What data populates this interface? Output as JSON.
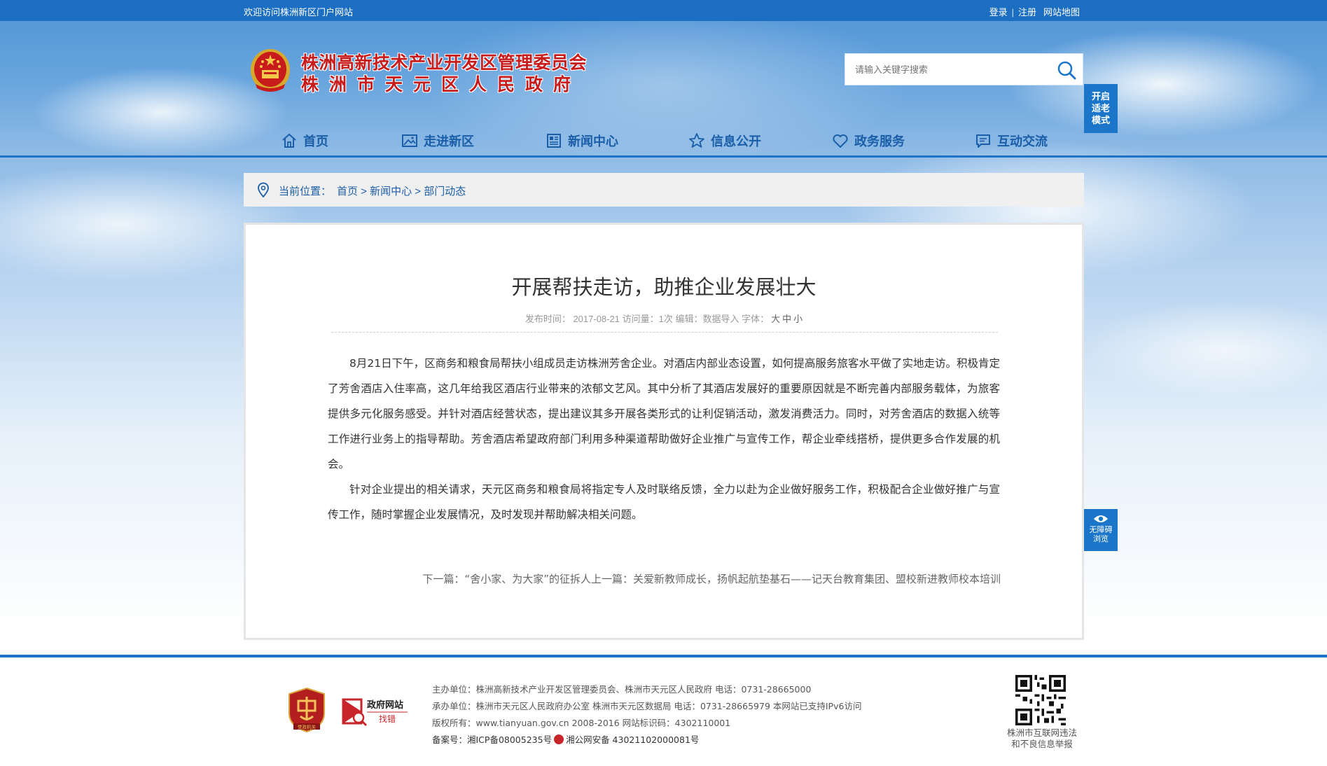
{
  "topbar": {
    "welcome": "欢迎访问株洲新区门户网站",
    "login": "登录",
    "register": "注册",
    "sitemap": "网站地图",
    "separator": "|"
  },
  "header": {
    "title_line1": "株洲高新技术产业开发区管理委员会",
    "title_line2": "株洲市天元区人民政府",
    "search_placeholder": "请输入关键字搜索",
    "elder_mode": [
      "开启",
      "适老",
      "模式"
    ]
  },
  "nav": {
    "items": [
      {
        "label": "首页",
        "icon": "home-icon"
      },
      {
        "label": "走进新区",
        "icon": "picture-icon"
      },
      {
        "label": "新闻中心",
        "icon": "news-icon"
      },
      {
        "label": "信息公开",
        "icon": "star-icon"
      },
      {
        "label": "政务服务",
        "icon": "heart-icon"
      },
      {
        "label": "互动交流",
        "icon": "chat-icon"
      }
    ]
  },
  "breadcrumb": {
    "label": "当前位置：",
    "items": [
      "首页",
      "新闻中心",
      "部门动态"
    ],
    "separator": " > "
  },
  "article": {
    "title": "开展帮扶走访，助推企业发展壮大",
    "meta": {
      "publish_label": "发布时间：",
      "publish_date": "2017-08-21",
      "views_label": "访问量：",
      "views": "1次",
      "editor_label": "编辑：",
      "editor": "数据导入",
      "font_label": "字体：",
      "font_sizes": [
        "大",
        "中",
        "小"
      ]
    },
    "paragraphs": [
      "8月21日下午，区商务和粮食局帮扶小组成员走访株洲芳舍企业。对酒店内部业态设置，如何提高服务旅客水平做了实地走访。积极肯定了芳舍酒店入住率高，这几年给我区酒店行业带来的浓郁文艺风。其中分析了其酒店发展好的重要原因就是不断完善内部服务载体，为旅客提供多元化服务感受。并针对酒店经营状态，提出建议其多开展各类形式的让利促销活动，激发消费活力。同时，对芳舍酒店的数据入统等工作进行业务上的指导帮助。芳舍酒店希望政府部门利用多种渠道帮助做好企业推广与宣传工作，帮企业牵线搭桥，提供更多合作发展的机会。",
      "针对企业提出的相关请求，天元区商务和粮食局将指定专人及时联络反馈，全力以赴为企业做好服务工作，积极配合企业做好推广与宣传工作，随时掌握企业发展情况，及时发现并帮助解决相关问题。"
    ],
    "pager": {
      "next_label": "下一篇：",
      "next_title": "“舍小家、为大家”的征拆人",
      "prev_label": "上一篇：",
      "prev_title": "关爱新教师成长，扬帆起航垫基石——记天台教育集团、盟校新进教师校本培训"
    }
  },
  "accessibility": {
    "label_line1": "无障碍",
    "label_line2": "浏览"
  },
  "footer": {
    "badge1_text": "党政机关",
    "badge2_line1": "政府网站",
    "badge2_line2": "找错",
    "lines": [
      "主办单位：株洲高新技术产业开发区管理委员会、株洲市天元区人民政府 电话：0731-28665000",
      "承办单位：株洲市天元区人民政府办公室 株洲市天元区数据局 电话：0731-28665979 本网站已支持IPv6访问",
      "版权所有：www.tianyuan.gov.cn 2008-2016 网站标识码：4302110001"
    ],
    "icp": "备案号：湘ICP备08005235号",
    "police": "湘公网安备 43021102000081号",
    "qr_caption_line1": "株洲市互联网违法",
    "qr_caption_line2": "和不良信息举报"
  },
  "colors": {
    "topbar": "#1b6ec2",
    "nav_text": "#1b5ea8",
    "title_red": "#c81b1b",
    "accent_blue": "#1e73c6"
  }
}
